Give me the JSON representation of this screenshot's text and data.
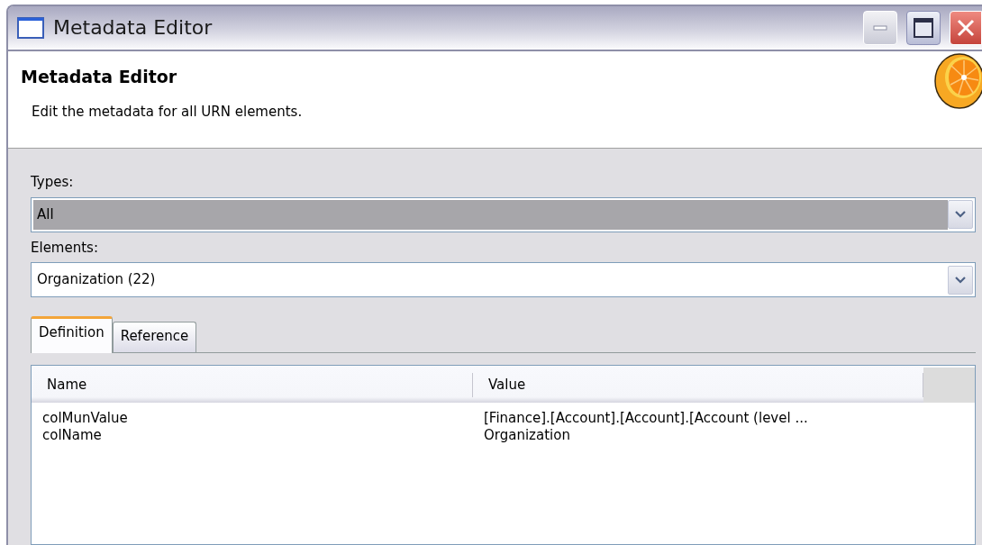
{
  "window": {
    "title": "Metadata Editor"
  },
  "header": {
    "title": "Metadata Editor",
    "description": "Edit the metadata for all URN elements."
  },
  "fields": [
    {
      "label": "Types:",
      "value": "All",
      "focused": true
    },
    {
      "label": "Elements:",
      "value": "Organization (22)",
      "focused": false
    }
  ],
  "tabs": [
    {
      "label": "Definition",
      "selected": true
    },
    {
      "label": "Reference",
      "selected": false
    }
  ],
  "table": {
    "columns": [
      "Name",
      "Value"
    ],
    "rows": [
      [
        "colMunValue",
        "[Finance].[Account].[Account].[Account (level ..."
      ],
      [
        "colName",
        "Organization"
      ]
    ]
  }
}
